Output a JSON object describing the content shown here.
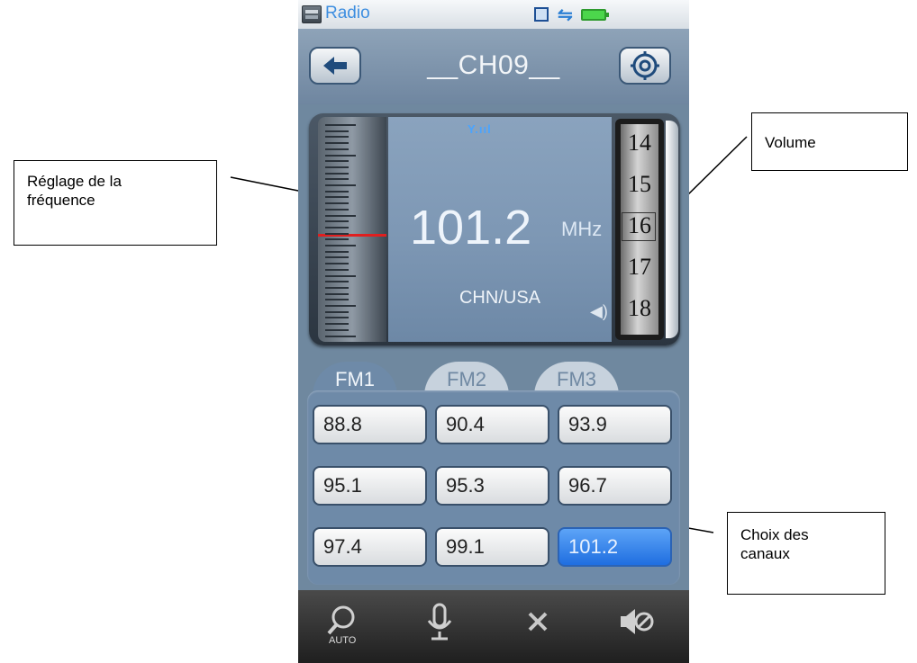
{
  "annotations": {
    "tuning": "Réglage de la\nfréquence",
    "volume": "Volume",
    "channels": "Choix des\ncanaux"
  },
  "status_bar": {
    "app_title": "Radio",
    "icons": [
      "radio-app-icon",
      "memory-card-icon",
      "usb-icon",
      "battery-icon"
    ]
  },
  "header": {
    "channel_name": "__CH09__",
    "back_icon": "arrow-left-icon",
    "settings_icon": "gear-icon"
  },
  "tuner": {
    "frequency": "101.2",
    "unit": "MHz",
    "region": "CHN/USA",
    "signal_icon": "antenna-signal-icon",
    "volume_numbers": [
      "14",
      "15",
      "16",
      "17",
      "18"
    ],
    "volume_selected": "16"
  },
  "band_tabs": [
    {
      "label": "FM1",
      "active": true
    },
    {
      "label": "FM2",
      "active": false
    },
    {
      "label": "FM3",
      "active": false
    }
  ],
  "presets": [
    "88.8",
    "90.4",
    "93.9",
    "95.1",
    "95.3",
    "96.7",
    "97.4",
    "99.1",
    "101.2"
  ],
  "preset_selected": "101.2",
  "toolbar": {
    "auto_label": "AUTO",
    "icons": [
      "search-auto-icon",
      "microphone-icon",
      "close-icon",
      "speaker-mute-icon"
    ]
  },
  "colors": {
    "accent_blue": "#3d8ee0",
    "selected_preset": "#2f80ea",
    "tuning_needle": "#e01f1f"
  }
}
